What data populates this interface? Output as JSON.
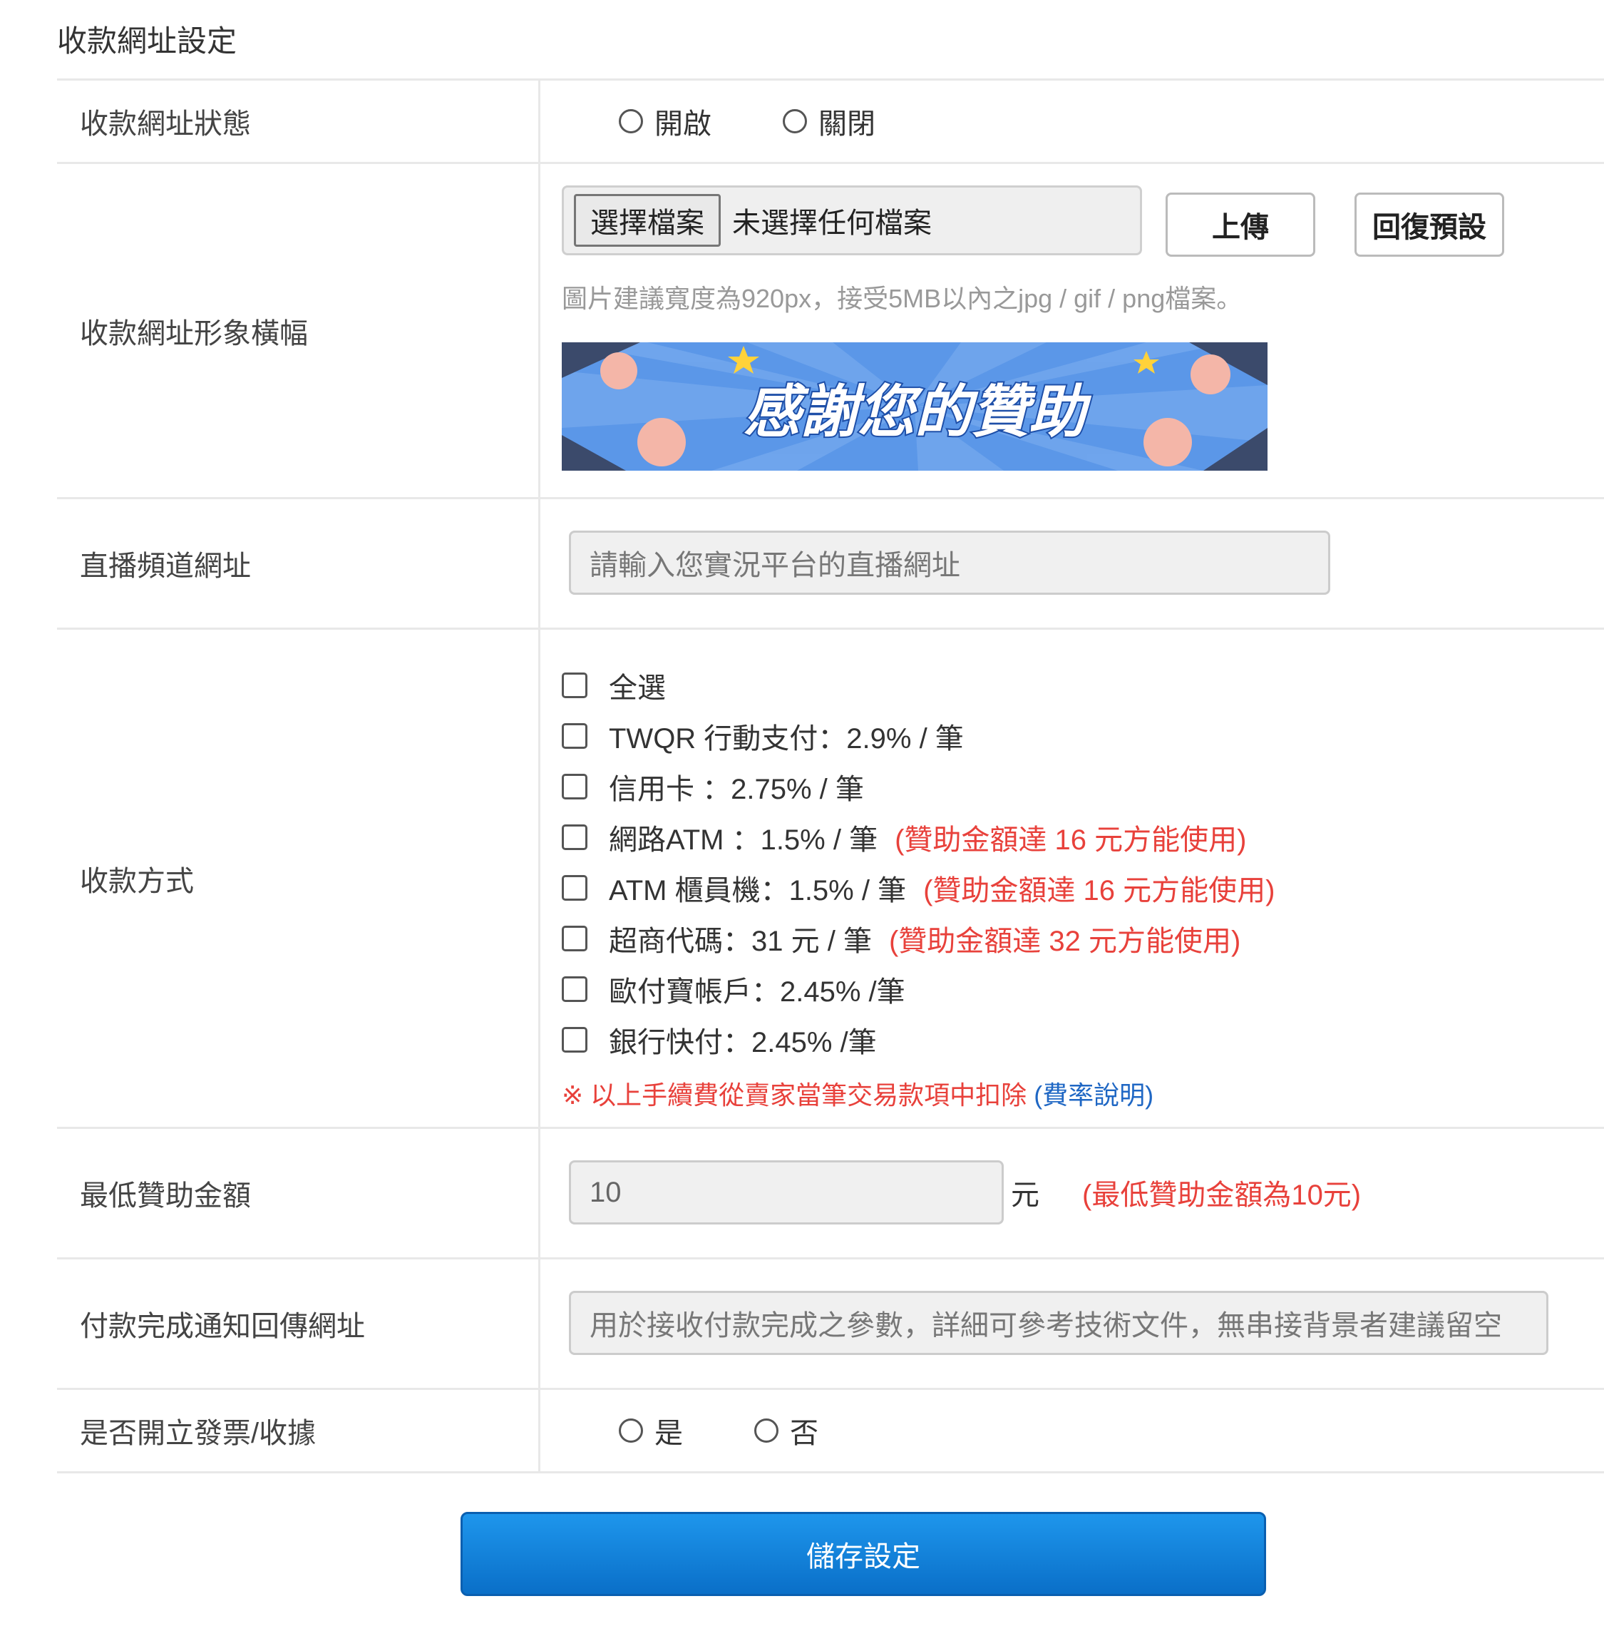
{
  "section_title": "收款網址設定",
  "rows": {
    "status": {
      "label": "收款網址狀態",
      "options": [
        "開啟",
        "關閉"
      ]
    },
    "banner": {
      "label": "收款網址形象橫幅",
      "choose_file": "選擇檔案",
      "no_file": "未選擇任何檔案",
      "upload": "上傳",
      "reset": "回復預設",
      "hint": "圖片建議寬度為920px，接受5MB以內之jpg / gif / png檔案。",
      "banner_text": "感謝您的贊助"
    },
    "live_url": {
      "label": "直播頻道網址",
      "placeholder": "請輸入您實況平台的直播網址"
    },
    "payment": {
      "label": "收款方式",
      "items": [
        {
          "text": "全選",
          "note": ""
        },
        {
          "text": "TWQR 行動支付：2.9% / 筆",
          "note": ""
        },
        {
          "text": "信用卡 ：2.75% / 筆",
          "note": ""
        },
        {
          "text": "網路ATM ：1.5% / 筆",
          "note": "(贊助金額達 16 元方能使用)"
        },
        {
          "text": "ATM 櫃員機：1.5% / 筆",
          "note": "(贊助金額達 16 元方能使用)"
        },
        {
          "text": "超商代碼：31 元 / 筆",
          "note": "(贊助金額達 32 元方能使用)"
        },
        {
          "text": "歐付寶帳戶：2.45% /筆",
          "note": ""
        },
        {
          "text": "銀行快付：2.45% /筆",
          "note": ""
        }
      ],
      "fee_note": "※ 以上手續費從賣家當筆交易款項中扣除",
      "fee_link": "(費率說明)"
    },
    "min_amount": {
      "label": "最低贊助金額",
      "value": "10",
      "unit": "元",
      "note": "(最低贊助金額為10元)"
    },
    "callback": {
      "label": "付款完成通知回傳網址",
      "placeholder": "用於接收付款完成之參數，詳細可參考技術文件，無串接背景者建議留空"
    },
    "invoice": {
      "label": "是否開立發票/收據",
      "options": [
        "是",
        "否"
      ]
    }
  },
  "save_button": "儲存設定",
  "colors": {
    "accent_red": "#e8413b",
    "link_blue": "#1f67c4",
    "button_blue": "#0a6fc8"
  }
}
